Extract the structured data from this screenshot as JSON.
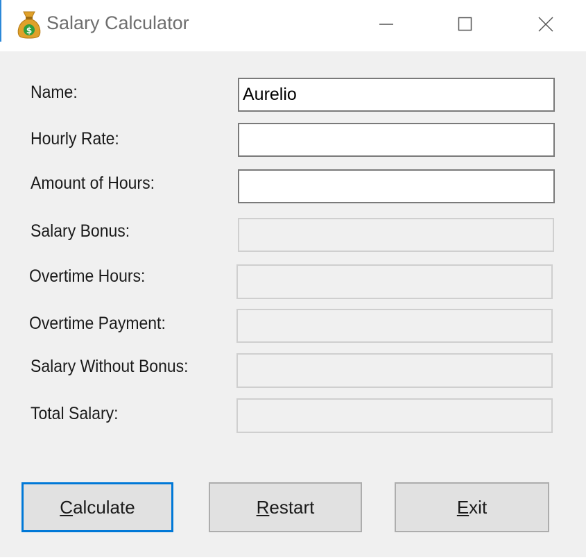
{
  "window": {
    "title": "Salary Calculator",
    "icon": "money-bag-icon",
    "controls": [
      "minimize-icon",
      "maximize-icon",
      "close-icon"
    ]
  },
  "form": {
    "name_label": "Name:",
    "name_value": "Aurelio",
    "hourly_rate_label": "Hourly Rate:",
    "hourly_rate_value": "",
    "amount_hours_label": "Amount of Hours:",
    "amount_hours_value": "",
    "salary_bonus_label": "Salary Bonus:",
    "salary_bonus_value": "",
    "overtime_hours_label": "Overtime Hours:",
    "overtime_hours_value": "",
    "overtime_payment_label": "Overtime Payment:",
    "overtime_payment_value": "",
    "salary_without_bonus_label": "Salary Without Bonus:",
    "salary_without_bonus_value": "",
    "total_salary_label": "Total Salary:",
    "total_salary_value": ""
  },
  "buttons": {
    "calculate": {
      "mnemonic": "C",
      "rest": "alculate"
    },
    "restart": {
      "mnemonic": "R",
      "rest": "estart"
    },
    "exit": {
      "mnemonic": "E",
      "rest": "xit"
    }
  },
  "colors": {
    "accent": "#0078d7",
    "window_bg": "#f0f0f0",
    "icon_bag": "#e0a12a",
    "icon_coin": "#2e9e3f"
  }
}
